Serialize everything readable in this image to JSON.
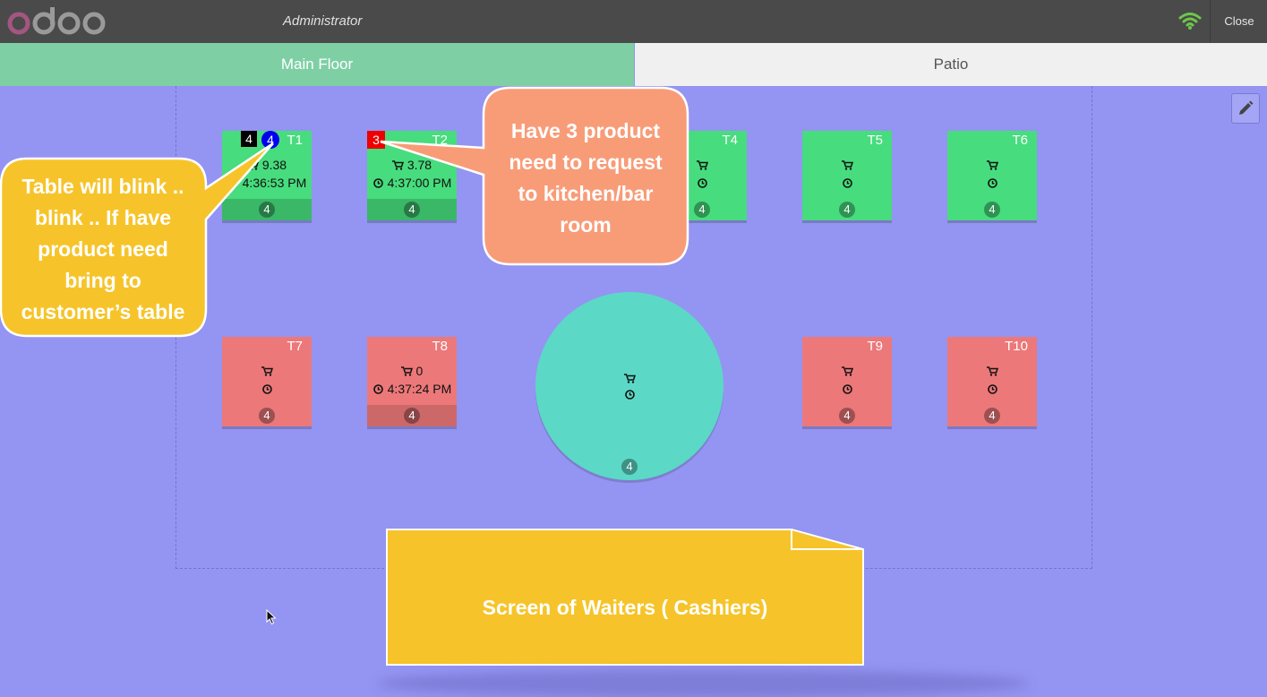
{
  "header": {
    "logo": "odoo",
    "user": "Administrator",
    "wifi_icon": "wifi-icon",
    "close_label": "Close"
  },
  "tabs": [
    {
      "label": "Main Floor",
      "active": true
    },
    {
      "label": "Patio",
      "active": false
    }
  ],
  "tables": [
    {
      "name": "T1",
      "amount": "9.38",
      "time": "4:36:53 PM",
      "seats": "4",
      "badge_count": "4",
      "badge_ready": "4",
      "status": "occupied"
    },
    {
      "name": "T2",
      "amount": "3.78",
      "time": "4:37:00 PM",
      "seats": "4",
      "badge_count": "3",
      "status": "occupied"
    },
    {
      "name": "T4",
      "amount": "",
      "time": "",
      "seats": "4",
      "status": "free"
    },
    {
      "name": "T5",
      "amount": "",
      "time": "",
      "seats": "4",
      "status": "free"
    },
    {
      "name": "T6",
      "amount": "",
      "time": "",
      "seats": "4",
      "status": "free"
    },
    {
      "name": "T7",
      "amount": "",
      "time": "",
      "seats": "4",
      "status": "free"
    },
    {
      "name": "T8",
      "amount": "0",
      "time": "4:37:24 PM",
      "seats": "4",
      "status": "occupied"
    },
    {
      "name": "",
      "amount": "",
      "time": "",
      "seats": "4",
      "status": "free",
      "shape": "round"
    },
    {
      "name": "T9",
      "amount": "",
      "time": "",
      "seats": "4",
      "status": "free"
    },
    {
      "name": "T10",
      "amount": "",
      "time": "",
      "seats": "4",
      "status": "free"
    }
  ],
  "annotations": {
    "blink": [
      "Table will blink ..",
      "blink .. If have",
      "product need",
      "bring to",
      "customer’s table"
    ],
    "request": [
      "Have 3 product",
      "need to request",
      "to kitchen/bar",
      "room"
    ],
    "note": "Screen of Waiters ( Cashiers)"
  },
  "colors": {
    "floor_bg": "#9494f2",
    "table_green": "#47dc7d",
    "table_red": "#ec7879",
    "round_table": "#5cd8c6",
    "tab_active": "#7fcfa5",
    "callout_yellow": "#f6c42a",
    "callout_orange": "#f89c78"
  }
}
